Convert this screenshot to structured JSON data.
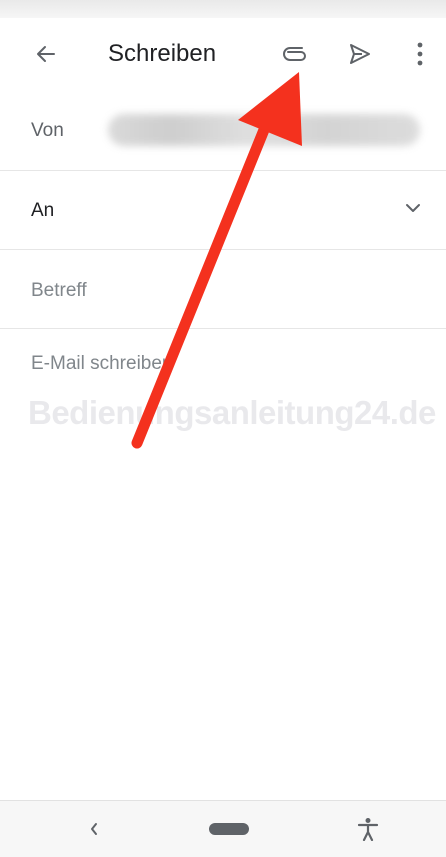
{
  "toolbar": {
    "title": "Schreiben",
    "icons": {
      "back": "arrow-left-icon",
      "attach": "paperclip-icon",
      "send": "send-icon",
      "more": "more-vertical-icon"
    }
  },
  "form": {
    "from_label": "Von",
    "to_label": "An",
    "subject_placeholder": "Betreff",
    "body_placeholder": "E-Mail schreiben"
  },
  "watermark": "Bedienungsanleitung24.de",
  "annotation": {
    "arrow_color": "#f4311e"
  },
  "navbar": {
    "icons": {
      "back": "chevron-left-icon",
      "home": "home-pill-icon",
      "accessibility": "accessibility-icon"
    }
  },
  "colors": {
    "text": "#202124",
    "secondary": "#5f6368",
    "placeholder": "#80868b",
    "divider": "#e6e6e6"
  }
}
